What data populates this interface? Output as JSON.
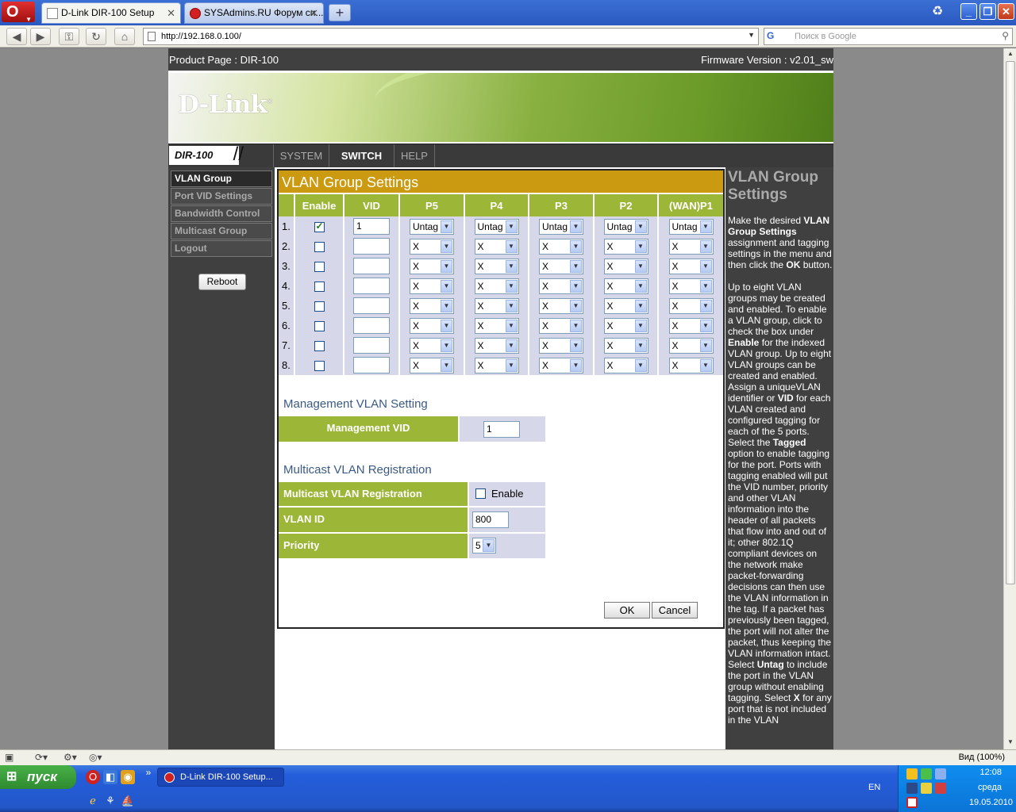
{
  "browser": {
    "tabs": [
      {
        "title": "D-Link DIR-100 Setup",
        "close": "✕"
      },
      {
        "title": "SYSAdmins.RU Форум си...",
        "close": "✕"
      }
    ],
    "new_tab": "+",
    "url": "http://192.168.0.100/",
    "search_placeholder": "Поиск в Google",
    "search_engine": "G",
    "zoom": "Вид (100%)"
  },
  "page": {
    "product": "Product Page : DIR-100",
    "firmware": "Firmware Version : v2.01_sw",
    "logo": "D-Link",
    "logo_mark": "®",
    "model": "DIR-100",
    "nav_tabs": [
      "SYSTEM",
      "SWITCH",
      "HELP"
    ],
    "left_menu": [
      "VLAN Group Settings",
      "Port VID Settings",
      "Bandwidth Control",
      "Multicast Group",
      "Logout"
    ],
    "reboot_label": "Reboot"
  },
  "vlan": {
    "title": "VLAN Group Settings",
    "headers": [
      "",
      "Enable",
      "VID",
      "P5",
      "P4",
      "P3",
      "P2",
      "(WAN)P1"
    ],
    "rows": [
      {
        "num": "1.",
        "enabled": true,
        "vid": "1",
        "ports": [
          "Untag",
          "Untag",
          "Untag",
          "Untag",
          "Untag"
        ]
      },
      {
        "num": "2.",
        "enabled": false,
        "vid": "",
        "ports": [
          "X",
          "X",
          "X",
          "X",
          "X"
        ]
      },
      {
        "num": "3.",
        "enabled": false,
        "vid": "",
        "ports": [
          "X",
          "X",
          "X",
          "X",
          "X"
        ]
      },
      {
        "num": "4.",
        "enabled": false,
        "vid": "",
        "ports": [
          "X",
          "X",
          "X",
          "X",
          "X"
        ]
      },
      {
        "num": "5.",
        "enabled": false,
        "vid": "",
        "ports": [
          "X",
          "X",
          "X",
          "X",
          "X"
        ]
      },
      {
        "num": "6.",
        "enabled": false,
        "vid": "",
        "ports": [
          "X",
          "X",
          "X",
          "X",
          "X"
        ]
      },
      {
        "num": "7.",
        "enabled": false,
        "vid": "",
        "ports": [
          "X",
          "X",
          "X",
          "X",
          "X"
        ]
      },
      {
        "num": "8.",
        "enabled": false,
        "vid": "",
        "ports": [
          "X",
          "X",
          "X",
          "X",
          "X"
        ]
      }
    ]
  },
  "management": {
    "heading": "Management VLAN Setting",
    "label": "Management VID",
    "value": "1"
  },
  "multicast": {
    "heading": "Multicast VLAN Registration",
    "reg_label": "Multicast VLAN Registration",
    "enable_label": "Enable",
    "vlan_id_label": "VLAN ID",
    "vlan_id_value": "800",
    "priority_label": "Priority",
    "priority_value": "5"
  },
  "buttons": {
    "ok": "OK",
    "cancel": "Cancel"
  },
  "help": {
    "title": "VLAN Group Settings",
    "p1_a": "Make the desired ",
    "p1_b": "VLAN Group Settings",
    "p1_c": " assignment and tagging settings in the menu and then click the ",
    "p1_d": "OK",
    "p1_e": " button.",
    "p2_a": "Up to eight VLAN groups may be created and enabled. To enable a VLAN group, click to check the box under ",
    "p2_b": "Enable",
    "p2_c": " for the indexed VLAN group. Up to eight VLAN groups can be created and enabled. Assign a uniqueVLAN identifier or ",
    "p2_d": "VID",
    "p2_e": " for each VLAN created and configured tagging for each of the 5 ports. Select the ",
    "p2_f": "Tagged",
    "p2_g": " option to enable tagging for the port. Ports with tagging enabled will put the VID number, priority and other VLAN information into the header of all packets that flow into and out of it; other 802.1Q compliant devices on the network make packet-forwarding decisions can then use the VLAN information in the tag. If a packet has previously been tagged, the port will not alter the packet, thus keeping the VLAN information intact. Select ",
    "p2_h": "Untag",
    "p2_i": " to include the port in the VLAN group without enabling tagging. Select ",
    "p2_j": "X",
    "p2_k": " for any port that is not included in the VLAN"
  },
  "taskbar": {
    "start": "пуск",
    "task": "D-Link DIR-100 Setup...",
    "lang": "EN",
    "time": "12:08",
    "day": "среда",
    "date": "19.05.2010",
    "more": "»"
  }
}
